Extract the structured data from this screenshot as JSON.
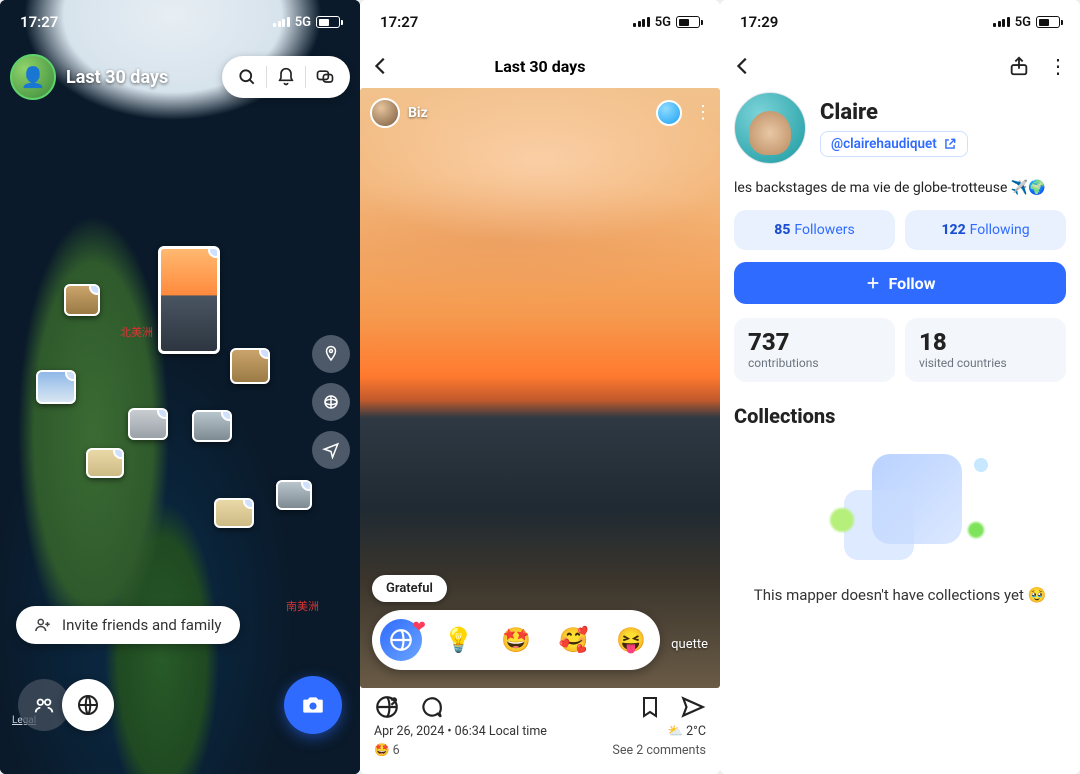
{
  "screen1": {
    "time": "17:27",
    "network": "5G",
    "title": "Last 30 days",
    "invite_label": "Invite friends and family",
    "legal": "Legal",
    "map_labels": {
      "na": "北美洲",
      "sa": "南美洲"
    }
  },
  "screen2": {
    "time": "17:27",
    "network": "5G",
    "nav_title": "Last 30 days",
    "poster_name": "Biz",
    "mood_chip": "Grateful",
    "location_hint": "quette",
    "meta_line": "Apr 26, 2024 • 06:34 Local time",
    "temp": "2°C",
    "reaction_count": "6",
    "comments_link": "See 2 comments"
  },
  "screen3": {
    "time": "17:29",
    "network": "5G",
    "name": "Claire",
    "handle": "@clairehaudiquet",
    "bio": "les backstages de ma vie de globe-trotteuse ✈️🌍",
    "followers_n": "85",
    "followers_lbl": "Followers",
    "following_n": "122",
    "following_lbl": "Following",
    "follow_btn": "Follow",
    "contrib_n": "737",
    "contrib_lbl": "contributions",
    "countries_n": "18",
    "countries_lbl": "visited countries",
    "collections_title": "Collections",
    "empty_msg": "This mapper doesn't have collections yet 🥹"
  }
}
